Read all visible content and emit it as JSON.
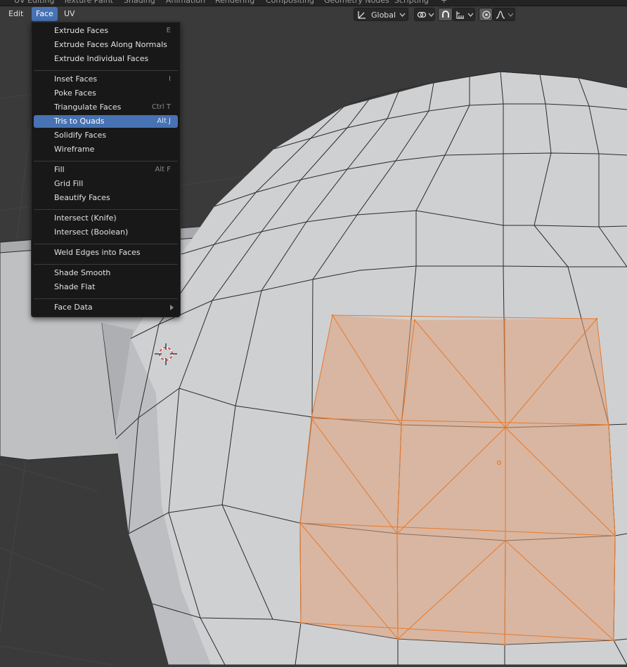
{
  "workspace_tabs": [
    "UV Editing",
    "Texture Paint",
    "Shading",
    "Animation",
    "Rendering",
    "Compositing",
    "Geometry Nodes",
    "Scripting",
    "+"
  ],
  "header": {
    "menus": [
      {
        "label": "Edit"
      },
      {
        "label": "Face"
      },
      {
        "label": "UV"
      }
    ],
    "transform_orientation": "Global",
    "icons": [
      "transform-orientation-icon",
      "pivot-link-icon",
      "snap-magnet-icon",
      "snap-increment-icon",
      "proportional-edit-icon",
      "falloff-curve-icon"
    ]
  },
  "face_menu": {
    "groups": [
      [
        {
          "label": "Extrude Faces",
          "shortcut": "E"
        },
        {
          "label": "Extrude Faces Along Normals",
          "shortcut": ""
        },
        {
          "label": "Extrude Individual Faces",
          "shortcut": ""
        }
      ],
      [
        {
          "label": "Inset Faces",
          "shortcut": "I"
        },
        {
          "label": "Poke Faces",
          "shortcut": ""
        },
        {
          "label": "Triangulate Faces",
          "shortcut": "Ctrl T"
        },
        {
          "label": "Tris to Quads",
          "shortcut": "Alt J",
          "highlighted": true
        },
        {
          "label": "Solidify Faces",
          "shortcut": ""
        },
        {
          "label": "Wireframe",
          "shortcut": ""
        }
      ],
      [
        {
          "label": "Fill",
          "shortcut": "Alt F"
        },
        {
          "label": "Grid Fill",
          "shortcut": ""
        },
        {
          "label": "Beautify Faces",
          "shortcut": ""
        }
      ],
      [
        {
          "label": "Intersect (Knife)",
          "shortcut": ""
        },
        {
          "label": "Intersect (Boolean)",
          "shortcut": ""
        }
      ],
      [
        {
          "label": "Weld Edges into Faces",
          "shortcut": ""
        }
      ],
      [
        {
          "label": "Shade Smooth",
          "shortcut": ""
        },
        {
          "label": "Shade Flat",
          "shortcut": ""
        }
      ],
      [
        {
          "label": "Face Data",
          "shortcut": "",
          "submenu": true
        }
      ]
    ]
  },
  "colors": {
    "background": "#3a3a3a",
    "mesh_face": "#cfd0d2",
    "mesh_wire": "#2a2a2a",
    "selection": "#e8792c",
    "selected_face_fill": "#e0a078",
    "menu_bg": "#181818",
    "menu_highlight": "#4772b3"
  }
}
